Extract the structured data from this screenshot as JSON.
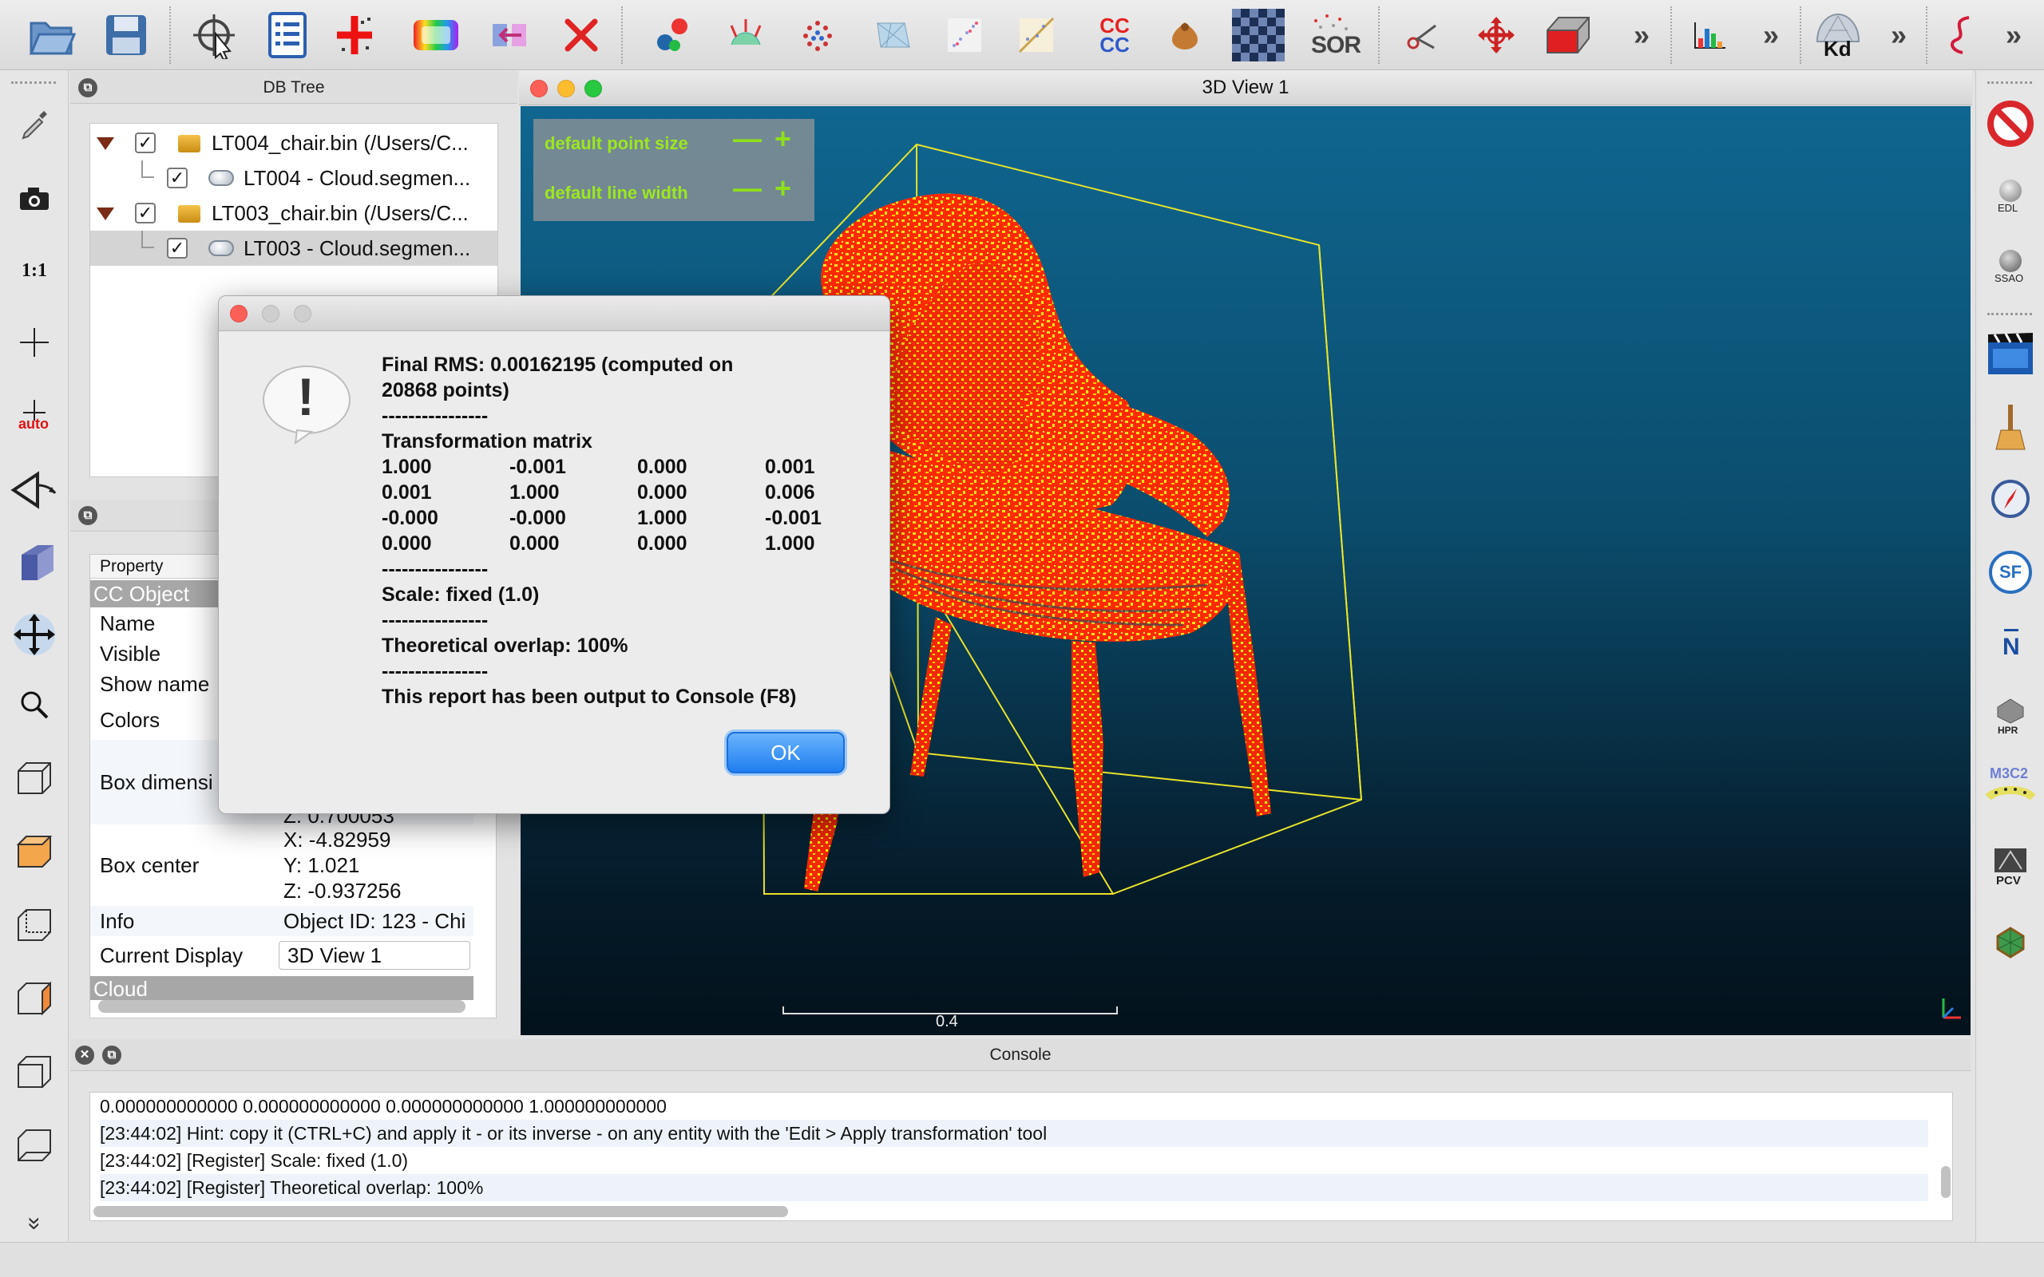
{
  "toolbar": {
    "icons": [
      "open-icon",
      "save-icon",
      "pick-rotation-center-icon",
      "properties-list-icon",
      "new-point-icon",
      "color-scale-icon",
      "merge-icon",
      "delete-icon",
      "segment-icon",
      "normals-icon",
      "points-sample-icon",
      "mesh-icon",
      "subsample-icon",
      "cross-section-icon",
      "compare-cc-icon",
      "label-icon",
      "checkerboard-icon",
      "sor-filter-icon",
      "scissors-icon",
      "translate-rotate-icon",
      "box-icon",
      "histogram-icon",
      "kd-tree-icon",
      "spline-icon"
    ],
    "cc_label": "CC\nCC",
    "sor_label": "SOR",
    "kd_label": "Kd"
  },
  "left_toolbar": {
    "one_to_one_label": "1:1",
    "auto_label": "auto"
  },
  "right_toolbar": {
    "edl_label": "EDL",
    "ssao_label": "SSAO",
    "hpr_label": "HPR",
    "m3c2_label": "M3C2",
    "pcv_label": "PCV",
    "sf_label": "SF",
    "n_label": "N"
  },
  "db_tree": {
    "title": "DB Tree",
    "rows": [
      {
        "label": "LT004_chair.bin (/Users/C...",
        "checked": "✓"
      },
      {
        "label": "LT004 - Cloud.segmen...",
        "checked": "✓"
      },
      {
        "label": "LT003_chair.bin (/Users/C...",
        "checked": "✓"
      },
      {
        "label": "LT003 - Cloud.segmen...",
        "checked": "✓"
      }
    ]
  },
  "properties": {
    "header": "Property",
    "section": "CC Object",
    "rows": [
      {
        "key": "Name",
        "val": ""
      },
      {
        "key": "Visible",
        "val": ""
      },
      {
        "key": "Show name",
        "val": ""
      },
      {
        "key": "Colors",
        "val": ""
      },
      {
        "key": "Box dimensi",
        "val": ""
      },
      {
        "key": "",
        "val": "Z: 0.700053"
      },
      {
        "key": "",
        "val": "X: -4.82959"
      },
      {
        "key": "Box center",
        "val": "Y: 1.021"
      },
      {
        "key": "",
        "val": "Z: -0.937256"
      },
      {
        "key": "Info",
        "val": "Object ID: 123 - Chi"
      },
      {
        "key": "Current Display",
        "val": "3D View 1"
      }
    ],
    "next_section": "Cloud"
  },
  "view3d": {
    "title": "3D View 1",
    "hud": {
      "point_size_label": "default point size",
      "line_width_label": "default line width",
      "minus": "—",
      "plus": "+"
    },
    "scale_label": "0.4"
  },
  "console": {
    "title": "Console",
    "lines": [
      "0.000000000000 0.000000000000 0.000000000000 1.000000000000",
      "[23:44:02] Hint: copy it (CTRL+C) and apply it - or its inverse - on any entity with the 'Edit > Apply transformation' tool",
      "[23:44:02] [Register] Scale: fixed (1.0)",
      "[23:44:02] [Register] Theoretical overlap: 100%"
    ]
  },
  "dialog": {
    "rms_line1": "Final RMS: 0.00162195 (computed on",
    "rms_line2": "20868 points)",
    "sep": "----------------",
    "matrix_title": "Transformation matrix",
    "matrix": [
      [
        "1.000",
        "-0.001",
        "0.000",
        "0.001"
      ],
      [
        "0.001",
        "1.000",
        "0.000",
        "0.006"
      ],
      [
        "-0.000",
        "-0.000",
        "1.000",
        "-0.001"
      ],
      [
        "0.000",
        "0.000",
        "0.000",
        "1.000"
      ]
    ],
    "scale": "Scale: fixed (1.0)",
    "overlap": "Theoretical overlap: 100%",
    "report": "This report has been output to Console (F8)",
    "ok_label": "OK",
    "alert_glyph": "!"
  }
}
